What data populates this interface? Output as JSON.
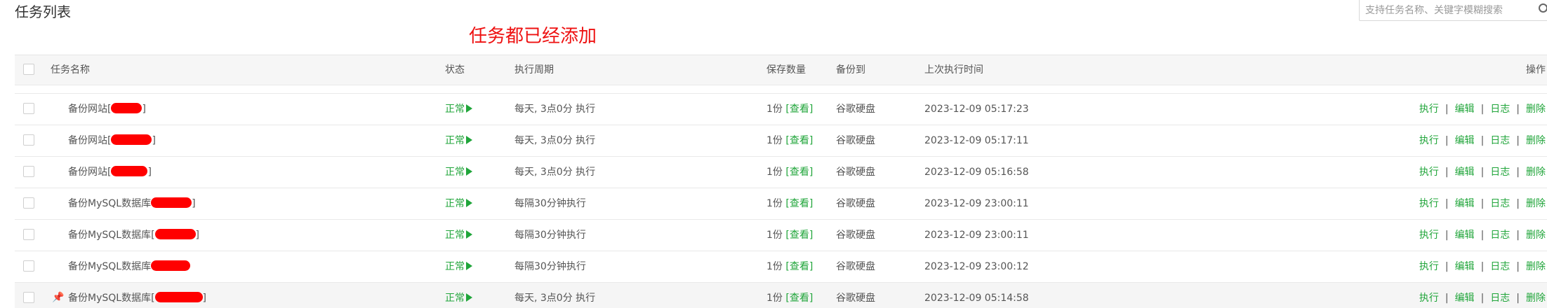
{
  "page": {
    "title": "任务列表",
    "annotation": "任务都已经添加",
    "search_placeholder": "支持任务名称、关键字模糊搜索"
  },
  "table": {
    "headers": {
      "name": "任务名称",
      "status": "状态",
      "cycle": "执行周期",
      "save_count": "保存数量",
      "backup_to": "备份到",
      "last_run": "上次执行时间",
      "actions": "操作"
    },
    "actions": {
      "run": "执行",
      "edit": "编辑",
      "log": "日志",
      "delete": "删除",
      "separator": "|"
    },
    "rows": [
      {
        "name_prefix": "备份网站[",
        "name_suffix": "]",
        "status": "正常",
        "cycle": "每天, 3点0分 执行",
        "save": "1份",
        "view": "[查看]",
        "dest": "谷歌硬盘",
        "last_run": "2023-12-09 05:17:23"
      },
      {
        "name_prefix": "备份网站[",
        "name_suffix": "]",
        "status": "正常",
        "cycle": "每天, 3点0分 执行",
        "save": "1份",
        "view": "[查看]",
        "dest": "谷歌硬盘",
        "last_run": "2023-12-09 05:17:11"
      },
      {
        "name_prefix": "备份网站[",
        "name_suffix": "]",
        "status": "正常",
        "cycle": "每天, 3点0分 执行",
        "save": "1份",
        "view": "[查看]",
        "dest": "谷歌硬盘",
        "last_run": "2023-12-09 05:16:58"
      },
      {
        "name_prefix": "备份MySQL数据库",
        "name_suffix": "]",
        "status": "正常",
        "cycle": "每隔30分钟执行",
        "save": "1份",
        "view": "[查看]",
        "dest": "谷歌硬盘",
        "last_run": "2023-12-09 23:00:11"
      },
      {
        "name_prefix": "备份MySQL数据库[",
        "name_suffix": "]",
        "status": "正常",
        "cycle": "每隔30分钟执行",
        "save": "1份",
        "view": "[查看]",
        "dest": "谷歌硬盘",
        "last_run": "2023-12-09 23:00:11"
      },
      {
        "name_prefix": "备份MySQL数据库",
        "name_suffix": "",
        "status": "正常",
        "cycle": "每隔30分钟执行",
        "save": "1份",
        "view": "[查看]",
        "dest": "谷歌硬盘",
        "last_run": "2023-12-09 23:00:12"
      },
      {
        "name_prefix": "备份MySQL数据库[",
        "name_suffix": "]",
        "status": "正常",
        "cycle": "每天, 3点0分 执行",
        "save": "1份",
        "view": "[查看]",
        "dest": "谷歌硬盘",
        "last_run": "2023-12-09 05:14:58"
      }
    ]
  },
  "colors": {
    "accent": "#20a53a",
    "annotation": "#ee1111",
    "redaction": "#ff0000"
  }
}
